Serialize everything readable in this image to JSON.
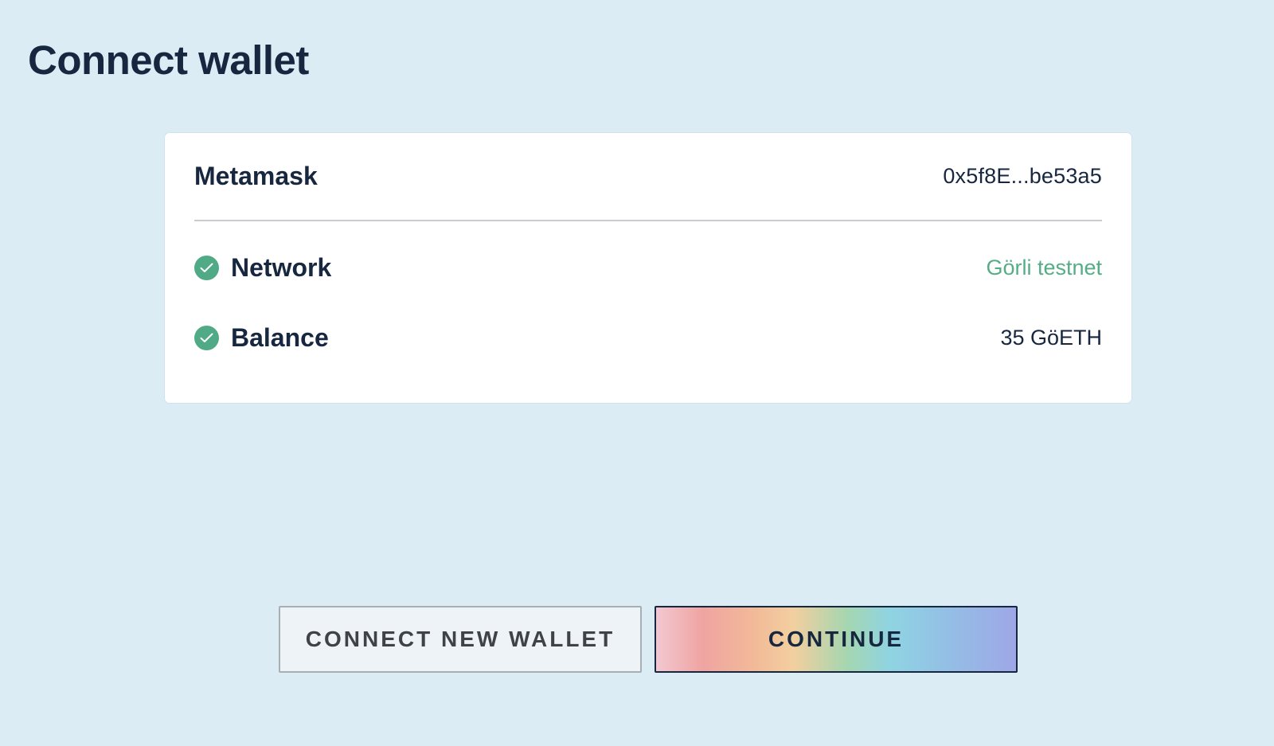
{
  "page": {
    "title": "Connect wallet"
  },
  "wallet": {
    "name": "Metamask",
    "address": "0x5f8E...be53a5"
  },
  "checks": [
    {
      "label": "Network",
      "value": "Görli testnet",
      "icon": "check-circle-icon",
      "status": "ok"
    },
    {
      "label": "Balance",
      "value": "35 GöETH",
      "icon": "check-circle-icon",
      "status": "ok"
    }
  ],
  "actions": {
    "connect_new_label": "CONNECT NEW WALLET",
    "continue_label": "CONTINUE"
  },
  "colors": {
    "background": "#dcecf5",
    "text_primary": "#16273f",
    "success": "#4faa85",
    "network_value": "#55ad86"
  }
}
